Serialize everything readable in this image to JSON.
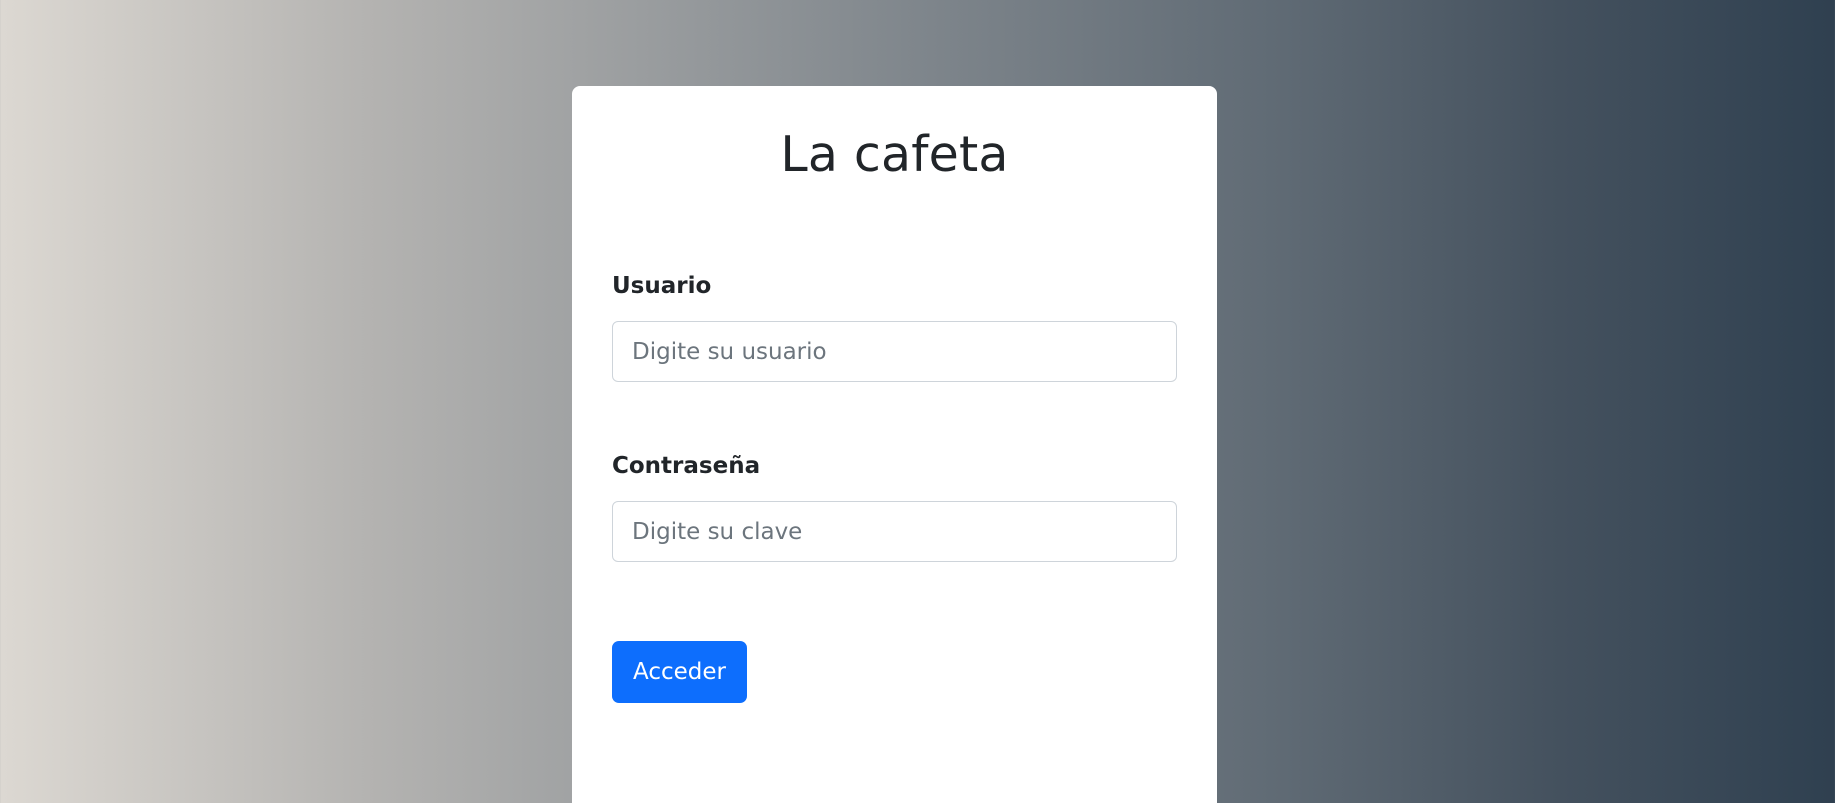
{
  "login": {
    "title": "La cafeta",
    "username_label": "Usuario",
    "username_placeholder": "Digite su usuario",
    "username_value": "",
    "password_label": "Contraseña",
    "password_placeholder": "Digite su clave",
    "password_value": "",
    "submit_label": "Acceder"
  },
  "colors": {
    "button": "#0d6efd",
    "text": "#212529",
    "placeholder": "#6c757d",
    "gradient_left": "#dcd8d2",
    "gradient_right": "#2f4050"
  }
}
